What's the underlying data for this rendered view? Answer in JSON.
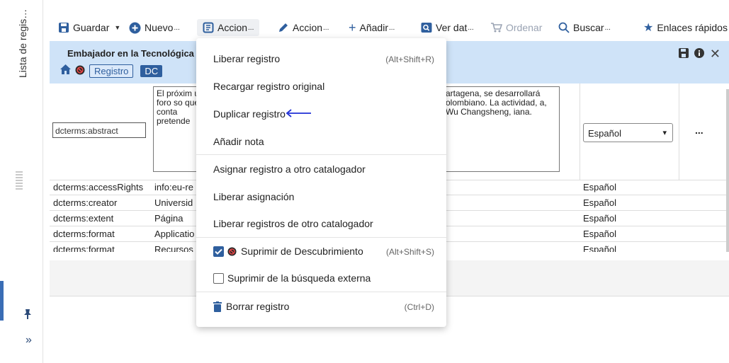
{
  "rail": {
    "title": "Lista de regis…"
  },
  "toolbar": {
    "guardar": "Guardar",
    "nuevo": "Nuevo",
    "accion1": "Accion",
    "accion2": "Accion",
    "anadir": "Añadir",
    "ver_dat": "Ver dat",
    "ordenar": "Ordenar",
    "buscar": "Buscar",
    "enlaces": "Enlaces rápidos",
    "ellipsis": "..."
  },
  "header": {
    "title": "Embajador en la Tecnológica",
    "chip_registro": "Registro",
    "chip_dc": "DC"
  },
  "record": {
    "abstract_field": "dcterms:abstract",
    "abstract_text_left": "El próxim un foro so que conta pretende",
    "abstract_text_right": "artagena, se desarrollará olombiano. La actividad, a, Wu Changsheng, iana.",
    "language": "Español",
    "more": "...",
    "rows": [
      {
        "field": "dcterms:accessRights",
        "value": "info:eu-re",
        "lang": "Español"
      },
      {
        "field": "dcterms:creator",
        "value": "Universid",
        "lang": "Español"
      },
      {
        "field": "dcterms:extent",
        "value": "Página",
        "lang": "Español"
      },
      {
        "field": "dcterms:format",
        "value": "Applicatio",
        "lang": "Español"
      },
      {
        "field": "dcterms:format",
        "value": "Recursos",
        "lang": "Español"
      }
    ]
  },
  "menu": {
    "liberar_registro": "Liberar registro",
    "liberar_shortcut": "(Alt+Shift+R)",
    "recargar": "Recargar registro original",
    "duplicar": "Duplicar registro",
    "anadir_nota": "Añadir nota",
    "asignar": "Asignar registro a otro catalogador",
    "liberar_asignacion": "Liberar asignación",
    "liberar_otro": "Liberar registros de otro catalogador",
    "suprimir_desc": "Suprimir de Descubrimiento",
    "suprimir_desc_shortcut": "(Alt+Shift+S)",
    "suprimir_ext": "Suprimir de la búsqueda externa",
    "borrar": "Borrar registro",
    "borrar_shortcut": "(Ctrl+D)"
  },
  "colors": {
    "accent": "#2f5f9e",
    "header_bg": "#cfe3f8",
    "annotation": "#1f2fd6"
  }
}
